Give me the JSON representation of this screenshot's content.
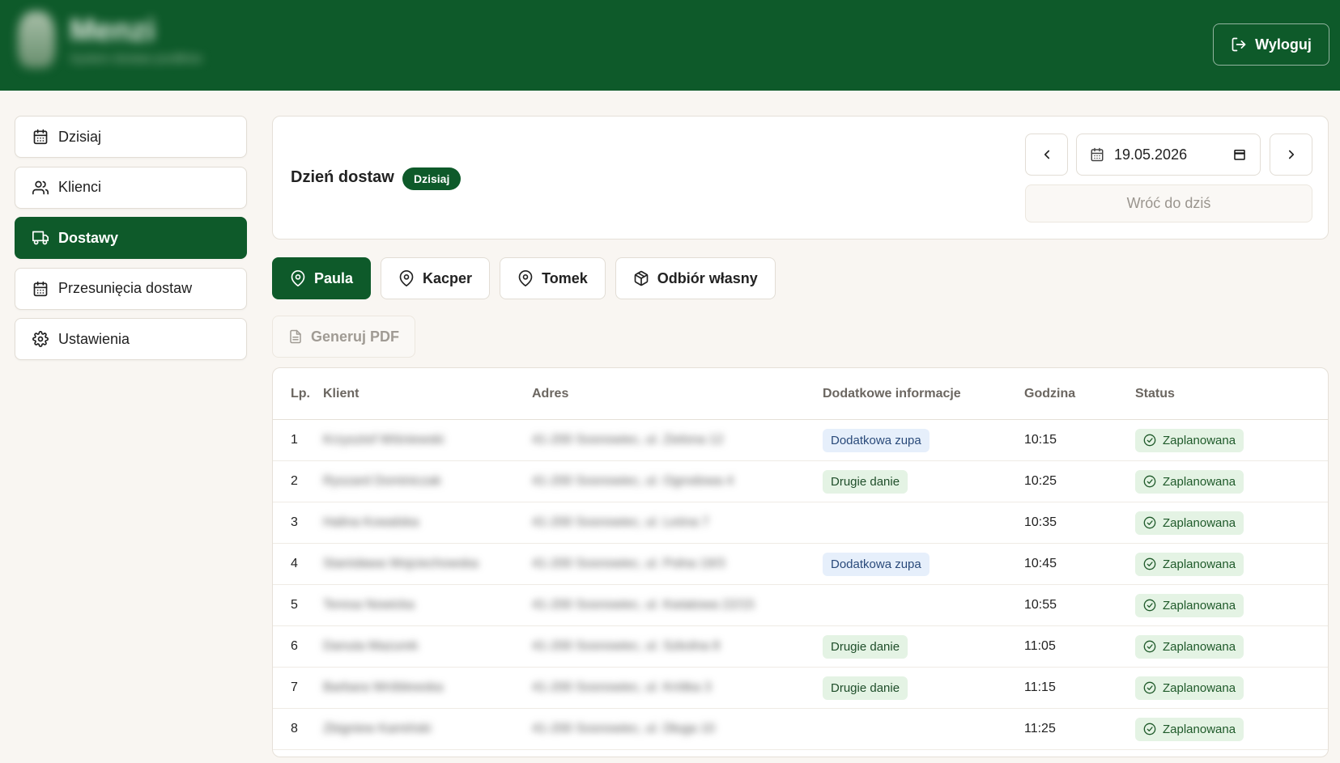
{
  "header": {
    "brand_name": "Menzi",
    "brand_subtitle": "System dostaw posiłków",
    "logout_label": "Wyloguj"
  },
  "sidebar": {
    "items": [
      {
        "label": "Dzisiaj",
        "icon": "calendar-icon",
        "active": false
      },
      {
        "label": "Klienci",
        "icon": "users-icon",
        "active": false
      },
      {
        "label": "Dostawy",
        "icon": "truck-icon",
        "active": true
      },
      {
        "label": "Przesunięcia dostaw",
        "icon": "calendar-icon",
        "active": false
      },
      {
        "label": "Ustawienia",
        "icon": "gear-icon",
        "active": false
      }
    ]
  },
  "day": {
    "title": "Dzień dostaw",
    "badge": "Dzisiaj",
    "date": "19.05.2026",
    "back_to_today": "Wróć do dziś"
  },
  "couriers": {
    "tabs": [
      {
        "label": "Paula",
        "icon": "map-pin-icon",
        "active": true
      },
      {
        "label": "Kacper",
        "icon": "map-pin-icon",
        "active": false
      },
      {
        "label": "Tomek",
        "icon": "map-pin-icon",
        "active": false
      },
      {
        "label": "Odbiór własny",
        "icon": "package-icon",
        "active": false
      }
    ]
  },
  "actions": {
    "pdf_label": "Generuj PDF"
  },
  "table": {
    "columns": [
      "Lp.",
      "Klient",
      "Adres",
      "Dodatkowe informacje",
      "Godzina",
      "Status"
    ],
    "rows": [
      {
        "lp": "1",
        "client": "Krzysztof Wiśniewski",
        "address": "41-200 Sosnowiec, ul. Zielona 12",
        "info": "Dodatkowa zupa",
        "info_type": "blue",
        "time": "10:15",
        "status": "Zaplanowana"
      },
      {
        "lp": "2",
        "client": "Ryszard Dominiczak",
        "address": "41-200 Sosnowiec, ul. Ogrodowa 4",
        "info": "Drugie danie",
        "info_type": "green",
        "time": "10:25",
        "status": "Zaplanowana"
      },
      {
        "lp": "3",
        "client": "Halina Kowalska",
        "address": "41-200 Sosnowiec, ul. Leśna 7",
        "info": "",
        "info_type": "",
        "time": "10:35",
        "status": "Zaplanowana"
      },
      {
        "lp": "4",
        "client": "Stanisława Wojciechowska",
        "address": "41-200 Sosnowiec, ul. Polna 19/3",
        "info": "Dodatkowa zupa",
        "info_type": "blue",
        "time": "10:45",
        "status": "Zaplanowana"
      },
      {
        "lp": "5",
        "client": "Teresa Nowicka",
        "address": "41-200 Sosnowiec, ul. Kwiatowa 22/15",
        "info": "",
        "info_type": "",
        "time": "10:55",
        "status": "Zaplanowana"
      },
      {
        "lp": "6",
        "client": "Danuta Mazurek",
        "address": "41-200 Sosnowiec, ul. Szkolna 8",
        "info": "Drugie danie",
        "info_type": "green",
        "time": "11:05",
        "status": "Zaplanowana"
      },
      {
        "lp": "7",
        "client": "Barbara Wróblewska",
        "address": "41-200 Sosnowiec, ul. Krótka 3",
        "info": "Drugie danie",
        "info_type": "green",
        "time": "11:15",
        "status": "Zaplanowana"
      },
      {
        "lp": "8",
        "client": "Zbigniew Kamiński",
        "address": "41-200 Sosnowiec, ul. Długa 10",
        "info": "",
        "info_type": "",
        "time": "11:25",
        "status": "Zaplanowana"
      }
    ]
  },
  "colors": {
    "primary": "#0e5a2a",
    "background": "#f9f6f2",
    "tag_blue_bg": "#e6effb",
    "tag_green_bg": "#e4f3e4"
  }
}
